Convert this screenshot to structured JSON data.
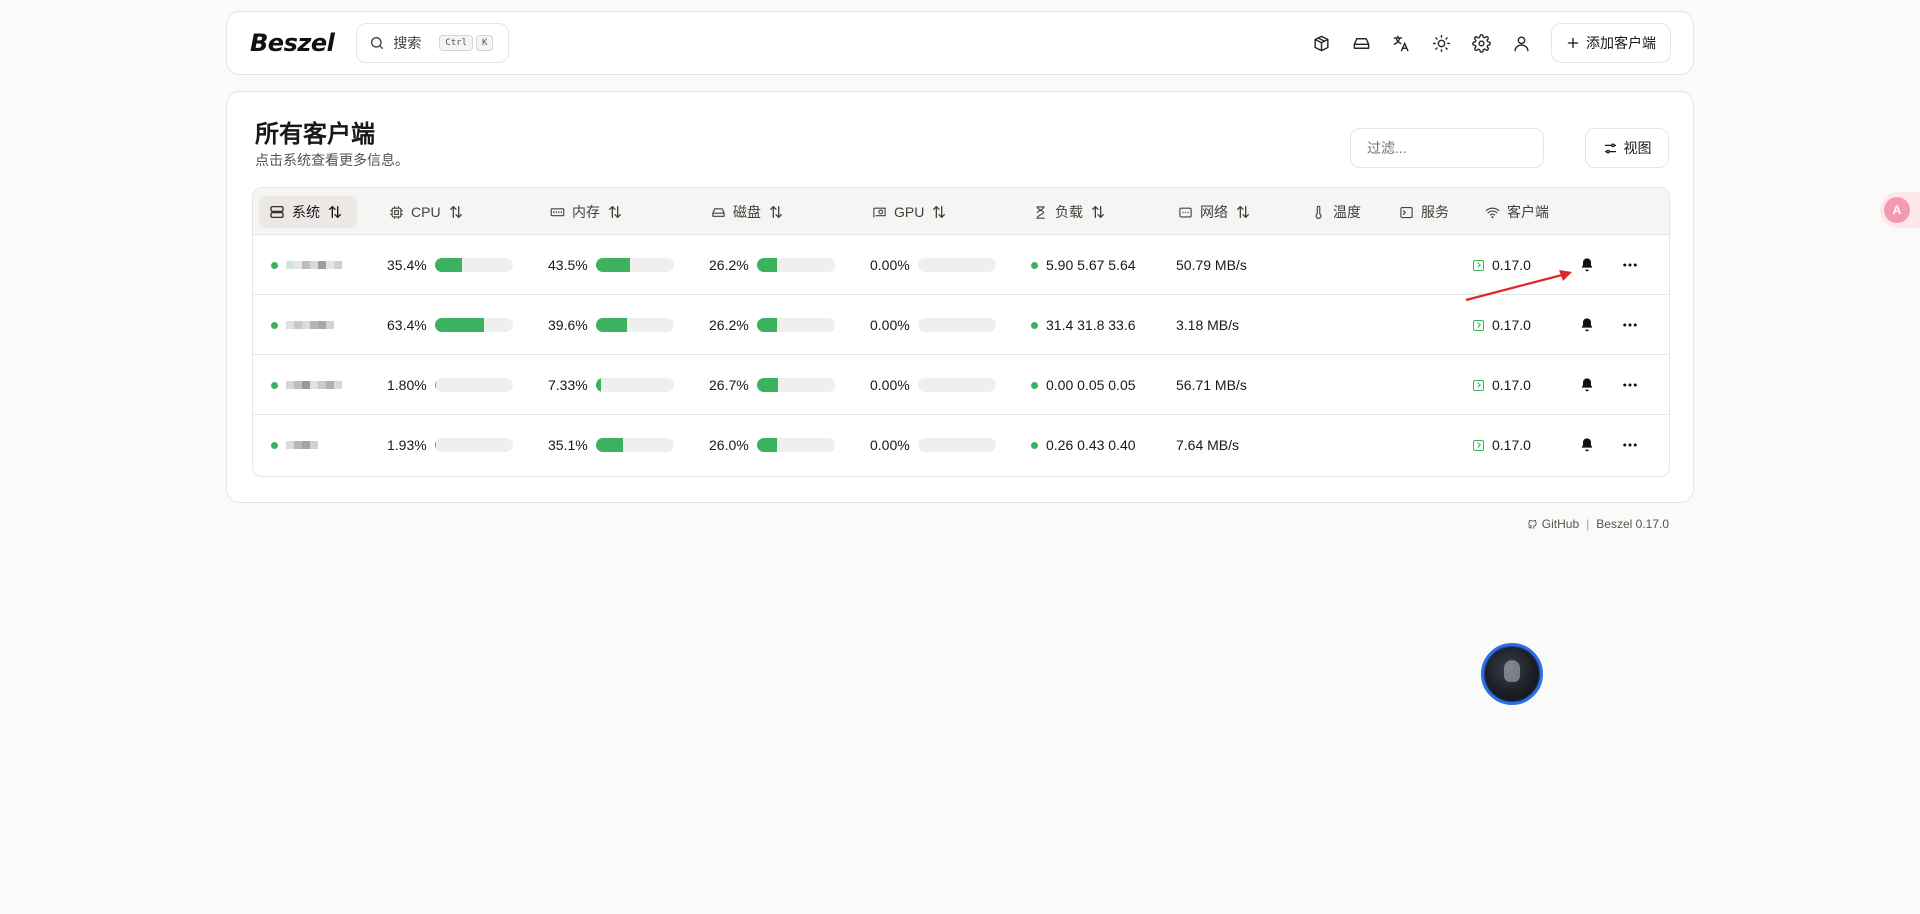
{
  "app": {
    "logo": "Beszel"
  },
  "search": {
    "label": "搜索",
    "kbd1": "Ctrl",
    "kbd2": "K"
  },
  "toolbar": {
    "add_client_label": "添加客户端"
  },
  "main": {
    "title": "所有客户端",
    "subtitle": "点击系统查看更多信息。",
    "filter_placeholder": "过滤...",
    "view_label": "视图"
  },
  "table": {
    "headers": {
      "system": "系统",
      "cpu": "CPU",
      "memory": "内存",
      "disk": "磁盘",
      "gpu": "GPU",
      "load": "负载",
      "network": "网络",
      "temperature": "温度",
      "services": "服务",
      "client": "客户端"
    },
    "rows": [
      {
        "cpu": "35.4%",
        "cpu_pct": 35.4,
        "mem": "43.5%",
        "mem_pct": 43.5,
        "disk": "26.2%",
        "disk_pct": 26.2,
        "gpu": "0.00%",
        "gpu_pct": 0,
        "load": "5.90 5.67 5.64",
        "net": "50.79 MB/s",
        "version": "0.17.0"
      },
      {
        "cpu": "63.4%",
        "cpu_pct": 63.4,
        "mem": "39.6%",
        "mem_pct": 39.6,
        "disk": "26.2%",
        "disk_pct": 26.2,
        "gpu": "0.00%",
        "gpu_pct": 0,
        "load": "31.4 31.8 33.6",
        "net": "3.18 MB/s",
        "version": "0.17.0"
      },
      {
        "cpu": "1.80%",
        "cpu_pct": 1.8,
        "mem": "7.33%",
        "mem_pct": 7.33,
        "disk": "26.7%",
        "disk_pct": 26.7,
        "gpu": "0.00%",
        "gpu_pct": 0,
        "load": "0.00 0.05 0.05",
        "net": "56.71 MB/s",
        "version": "0.17.0"
      },
      {
        "cpu": "1.93%",
        "cpu_pct": 1.93,
        "mem": "35.1%",
        "mem_pct": 35.1,
        "disk": "26.0%",
        "disk_pct": 26.0,
        "gpu": "0.00%",
        "gpu_pct": 0,
        "load": "0.26 0.43 0.40",
        "net": "7.64 MB/s",
        "version": "0.17.0"
      }
    ]
  },
  "footer": {
    "github": "GitHub",
    "version": "Beszel 0.17.0"
  },
  "colors": {
    "accent_green": "#3cb25f",
    "annotation_red": "#e0242b",
    "page_bg": "#fafaf9"
  }
}
